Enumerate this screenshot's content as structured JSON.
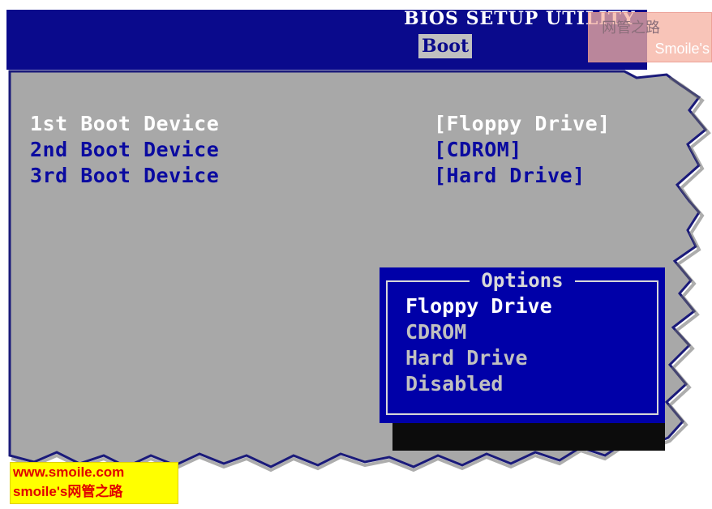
{
  "window": {
    "title": "BIOS SETUP UTILITY",
    "active_tab": "Boot"
  },
  "boot_devices": [
    {
      "label": "1st Boot Device",
      "value": "[Floppy Drive]",
      "highlighted": true
    },
    {
      "label": "2nd Boot Device",
      "value": "[CDROM]",
      "highlighted": false
    },
    {
      "label": "3rd Boot Device",
      "value": "[Hard Drive]",
      "highlighted": false
    }
  ],
  "options_popup": {
    "title": "Options",
    "items": [
      {
        "label": "Floppy Drive",
        "selected": true
      },
      {
        "label": "CDROM",
        "selected": false
      },
      {
        "label": "Hard Drive",
        "selected": false
      },
      {
        "label": "Disabled",
        "selected": false
      }
    ]
  },
  "watermark_top": {
    "cn": "网管之路",
    "en": "Smoile's"
  },
  "watermark_bottom": {
    "line1": "www.smoile.com",
    "line2": "smoile's网管之路"
  },
  "colors": {
    "header_blue": "#0a0a8c",
    "panel_gray": "#a8a8a8",
    "popup_blue": "#0000a8",
    "text_blue": "#0a0aa0",
    "text_white": "#ffffff"
  }
}
